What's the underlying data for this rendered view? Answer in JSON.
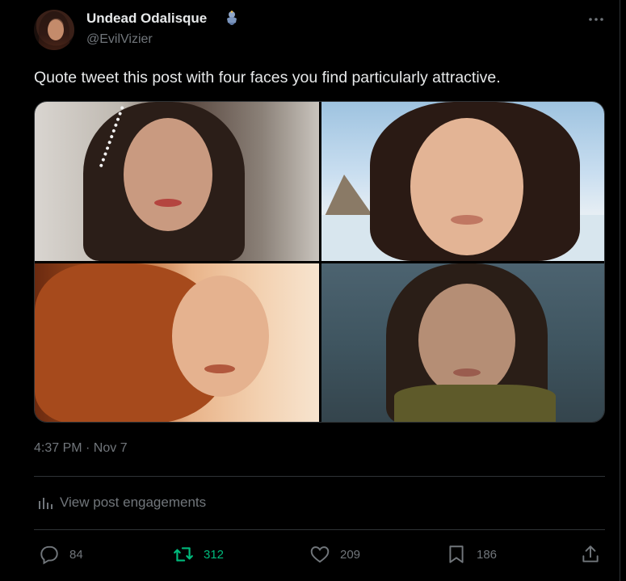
{
  "author": {
    "display_name": "Undead Odalisque",
    "handle": "@EvilVizier",
    "badge_icon": "genie-emoji-icon",
    "avatar_icon": "profile-avatar"
  },
  "post": {
    "text": "Quote tweet this post with four faces you find particularly attractive.",
    "timestamp": "4:37 PM · Nov 7",
    "media": [
      {
        "name": "media-photo-1"
      },
      {
        "name": "media-photo-2"
      },
      {
        "name": "media-photo-3"
      },
      {
        "name": "media-photo-4"
      }
    ]
  },
  "engagements": {
    "label": "View post engagements",
    "icon": "bar-chart-icon"
  },
  "actions": {
    "reply": {
      "count": "84",
      "icon": "reply-icon"
    },
    "retweet": {
      "count": "312",
      "icon": "retweet-icon",
      "color": "#00ba7c"
    },
    "like": {
      "count": "209",
      "icon": "heart-icon"
    },
    "bookmark": {
      "count": "186",
      "icon": "bookmark-icon"
    },
    "share": {
      "icon": "share-icon"
    }
  },
  "colors": {
    "background": "#000000",
    "text_primary": "#e7e9ea",
    "text_secondary": "#71767b",
    "divider": "#2f3336",
    "retweet_active": "#00ba7c"
  }
}
